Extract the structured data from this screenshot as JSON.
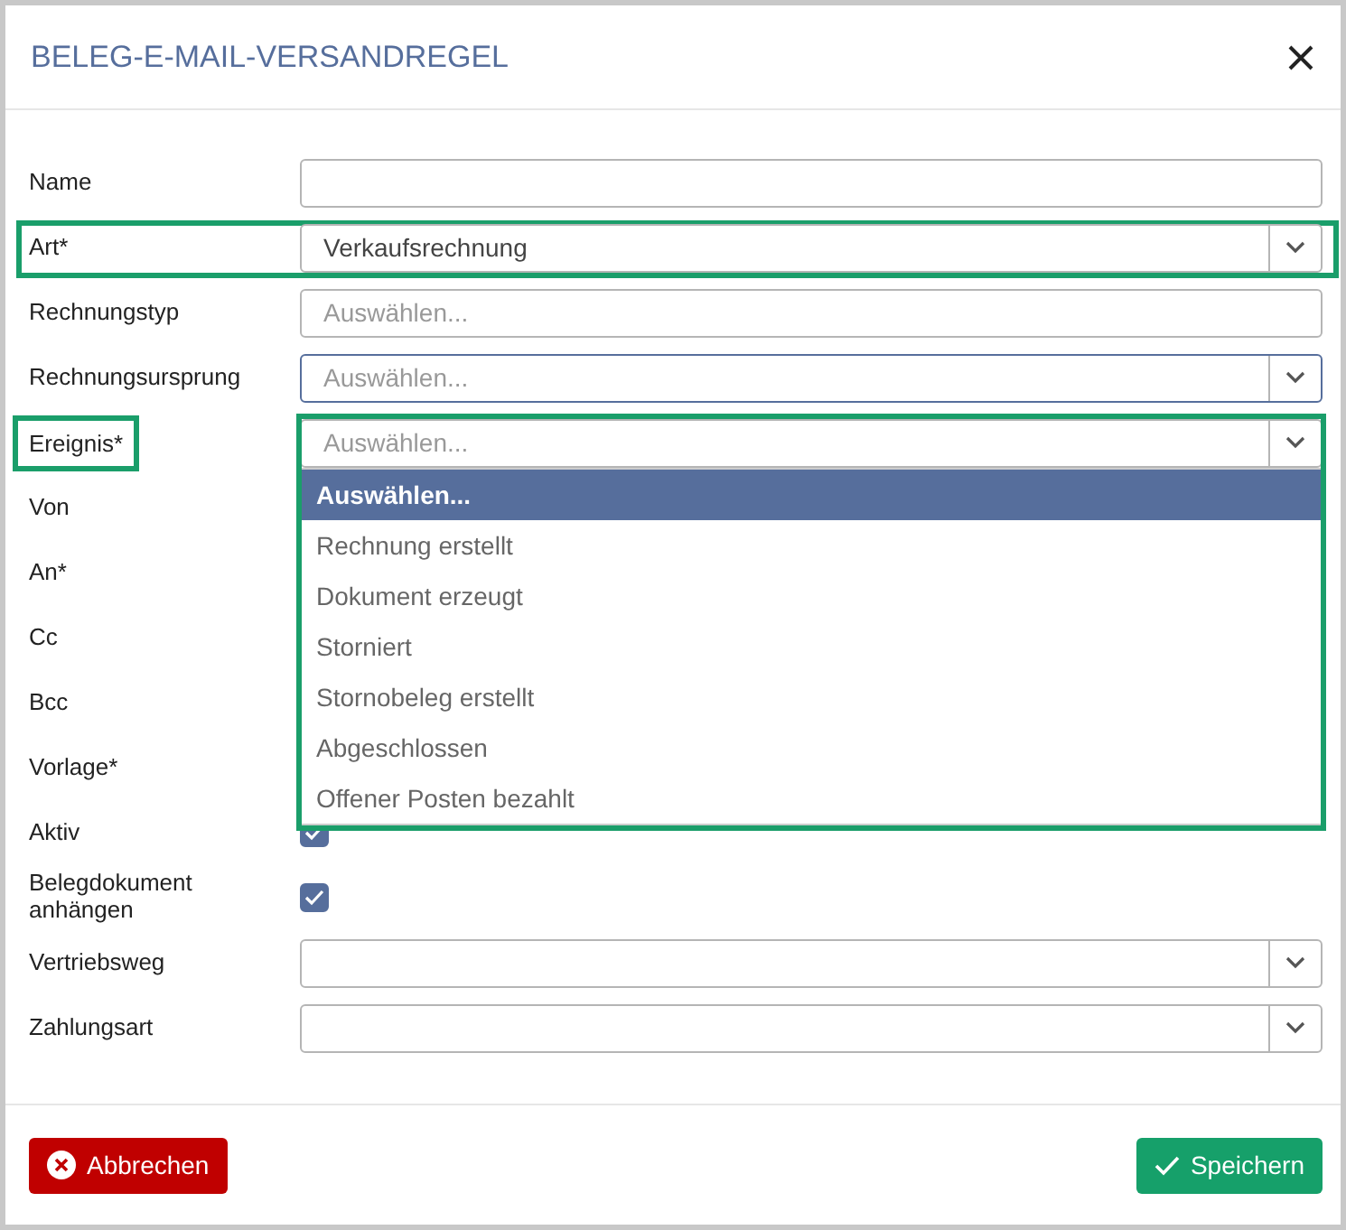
{
  "dialog": {
    "title": "BELEG-E-MAIL-VERSANDREGEL"
  },
  "fields": [
    {
      "label": "Name",
      "kind": "text"
    },
    {
      "label": "Art*",
      "kind": "select",
      "value": "Verkaufsrechnung",
      "row_framed": true
    },
    {
      "label": "Rechnungstyp",
      "kind": "text",
      "placeholder": "Auswählen..."
    },
    {
      "label": "Rechnungsursprung",
      "kind": "select",
      "placeholder": "Auswählen...",
      "focused": true
    },
    {
      "label": "Ereignis*",
      "kind": "select",
      "placeholder": "Auswählen...",
      "label_framed": true,
      "field_framed": true,
      "expanded": true,
      "options": [
        {
          "label": "Auswählen...",
          "selected": true
        },
        {
          "label": "Rechnung erstellt",
          "selected": false
        },
        {
          "label": "Dokument erzeugt",
          "selected": false
        },
        {
          "label": "Storniert",
          "selected": false
        },
        {
          "label": "Stornobeleg erstellt",
          "selected": false
        },
        {
          "label": "Abgeschlossen",
          "selected": false
        },
        {
          "label": "Offener Posten bezahlt",
          "selected": false
        }
      ]
    },
    {
      "label": "Von",
      "kind": "covered"
    },
    {
      "label": "An*",
      "kind": "covered"
    },
    {
      "label": "Cc",
      "kind": "covered"
    },
    {
      "label": "Bcc",
      "kind": "covered"
    },
    {
      "label": "Vorlage*",
      "kind": "covered"
    },
    {
      "label": "Aktiv",
      "kind": "checkbox",
      "checked": true
    },
    {
      "label": "Belegdokument anhängen",
      "kind": "checkbox",
      "checked": true
    },
    {
      "label": "Vertriebsweg",
      "kind": "select"
    },
    {
      "label": "Zahlungsart",
      "kind": "select"
    }
  ],
  "buttons": {
    "cancel": "Abbrechen",
    "save": "Speichern"
  }
}
